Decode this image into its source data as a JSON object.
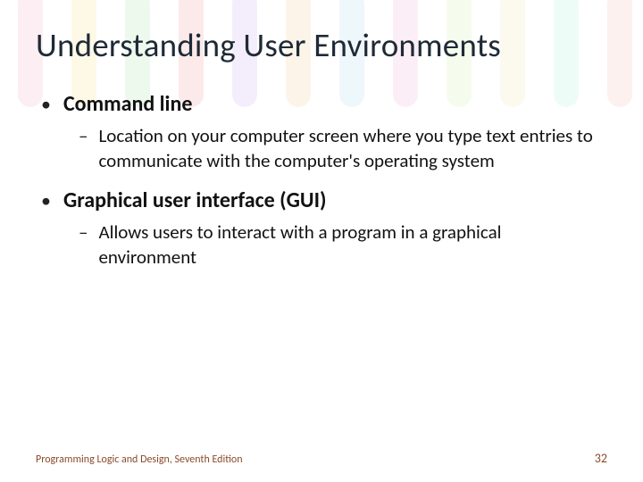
{
  "title": "Understanding User Environments",
  "bullets": [
    {
      "label": "Command line",
      "sub": [
        "Location on your computer screen where you type text entries to communicate with the computer's operating system"
      ]
    },
    {
      "label": "Graphical user interface (GUI)",
      "sub": [
        "Allows users to interact with a program in a graphical environment"
      ]
    }
  ],
  "footer": {
    "left": "Programming Logic and Design, Seventh Edition",
    "right": "32"
  },
  "stripe_colors": [
    "#f7a6c2",
    "#f9e27a",
    "#a7e3a1",
    "#f28c8c",
    "#c7a6f2",
    "#f7c58a",
    "#a6d8f2",
    "#f2a6d1",
    "#c9f2a6",
    "#f2e0a6",
    "#a6f2d6",
    "#f2b6a6"
  ]
}
